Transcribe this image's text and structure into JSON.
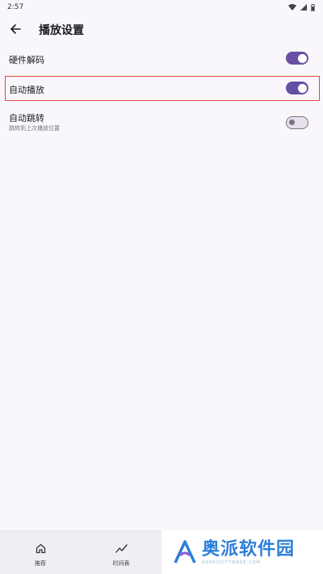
{
  "status_bar": {
    "time": "2:57"
  },
  "app_bar": {
    "title": "播放设置"
  },
  "settings": [
    {
      "label": "硬件解码",
      "enabled": true
    },
    {
      "label": "自动播放",
      "enabled": true
    },
    {
      "label": "自动跳转",
      "subtitle": "跳转到上次播放位置",
      "enabled": false
    }
  ],
  "bottom_nav": {
    "items": [
      {
        "label": "推荐",
        "icon": "home-icon"
      },
      {
        "label": "时间表",
        "icon": "trend-icon"
      }
    ]
  },
  "watermark": {
    "text": "奥派软件园",
    "url": "AOPAISOFTWARE.COM"
  },
  "colors": {
    "accent": "#6750a4",
    "highlight": "#e5473e",
    "watermark": "#2d7fd8"
  }
}
